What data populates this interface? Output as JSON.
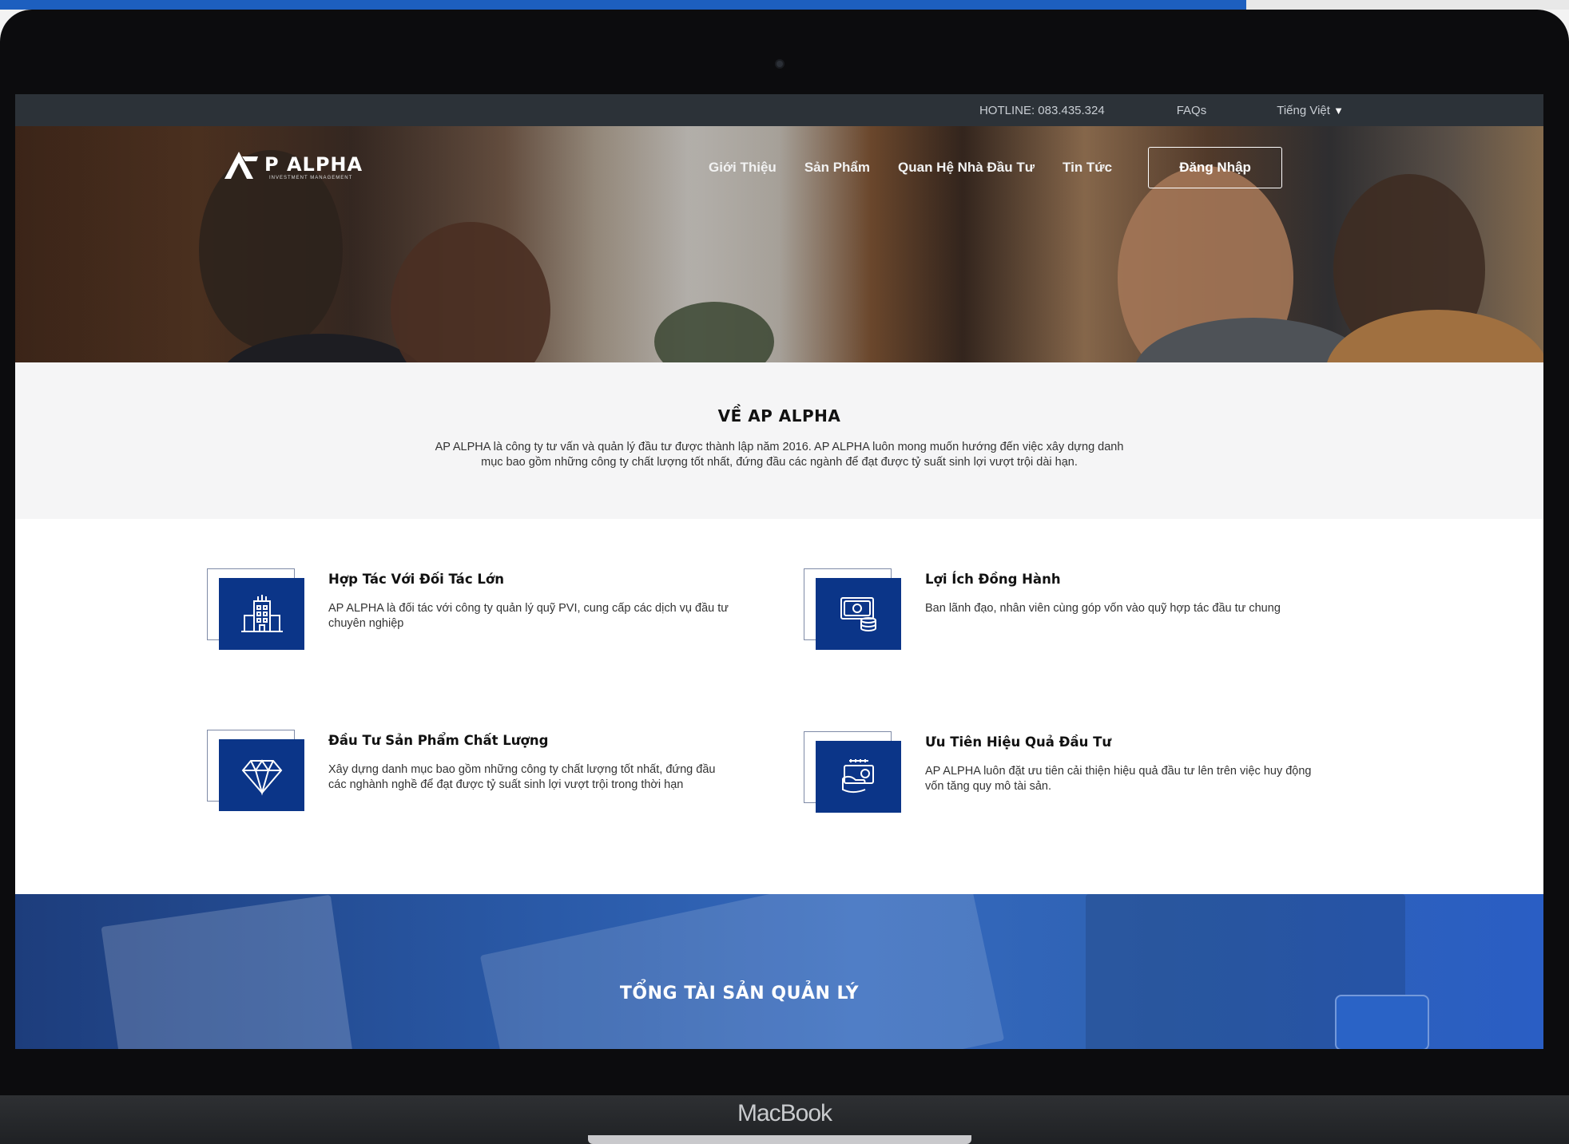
{
  "device": {
    "label": "MacBook"
  },
  "utility_bar": {
    "hotline": "HOTLINE: 083.435.324",
    "faqs": "FAQs",
    "language": "Tiếng Việt"
  },
  "header": {
    "logo_text": "P ALPHA",
    "logo_sub": "INVESTMENT MANAGEMENT",
    "nav": [
      "Giới Thiệu",
      "Sản Phẩm",
      "Quan Hệ Nhà Đầu Tư",
      "Tin Tức"
    ],
    "login_label": "Đăng Nhập"
  },
  "about": {
    "title": "VỀ AP ALPHA",
    "text_line1": "AP ALPHA là công ty tư vấn và quản lý đầu tư được thành lập năm 2016. AP ALPHA luôn mong muốn hướng đến việc xây dựng danh",
    "text_line2": "mục bao gồm những công ty chất lượng tốt nhất, đứng đầu các ngành để đạt được tỷ suất sinh lợi vượt trội dài hạn."
  },
  "features": [
    {
      "title": "Hợp Tác Với Đối Tác Lớn",
      "description": "AP ALPHA là đối tác với công ty quản lý quỹ PVI, cung cấp các dịch vụ đầu tư chuyên nghiệp",
      "icon": "building-icon"
    },
    {
      "title": "Lợi Ích Đồng Hành",
      "description": "Ban lãnh đạo, nhân viên cùng góp vốn vào quỹ hợp tác đầu tư chung",
      "icon": "money-coins-icon"
    },
    {
      "title": "Đầu Tư Sản Phẩm Chất Lượng",
      "description": "Xây dựng danh mục bao gồm những công ty chất lượng tốt nhất, đứng đầu các nghành nghề để đạt được tỷ suất sinh lợi vượt trội trong thời hạn",
      "icon": "diamond-icon"
    },
    {
      "title": "Ưu Tiên Hiệu Quả Đầu Tư",
      "description": "AP ALPHA luôn đặt ưu tiên cải thiện hiệu quả đầu tư lên trên việc huy động vốn tăng quy mô tài sản.",
      "icon": "hand-money-icon"
    }
  ],
  "banner": {
    "title": "TỔNG TÀI SẢN QUẢN LÝ"
  },
  "colors": {
    "brand_blue": "#0b3588",
    "topbar": "#2c3238",
    "banner": "#2f62b4"
  }
}
